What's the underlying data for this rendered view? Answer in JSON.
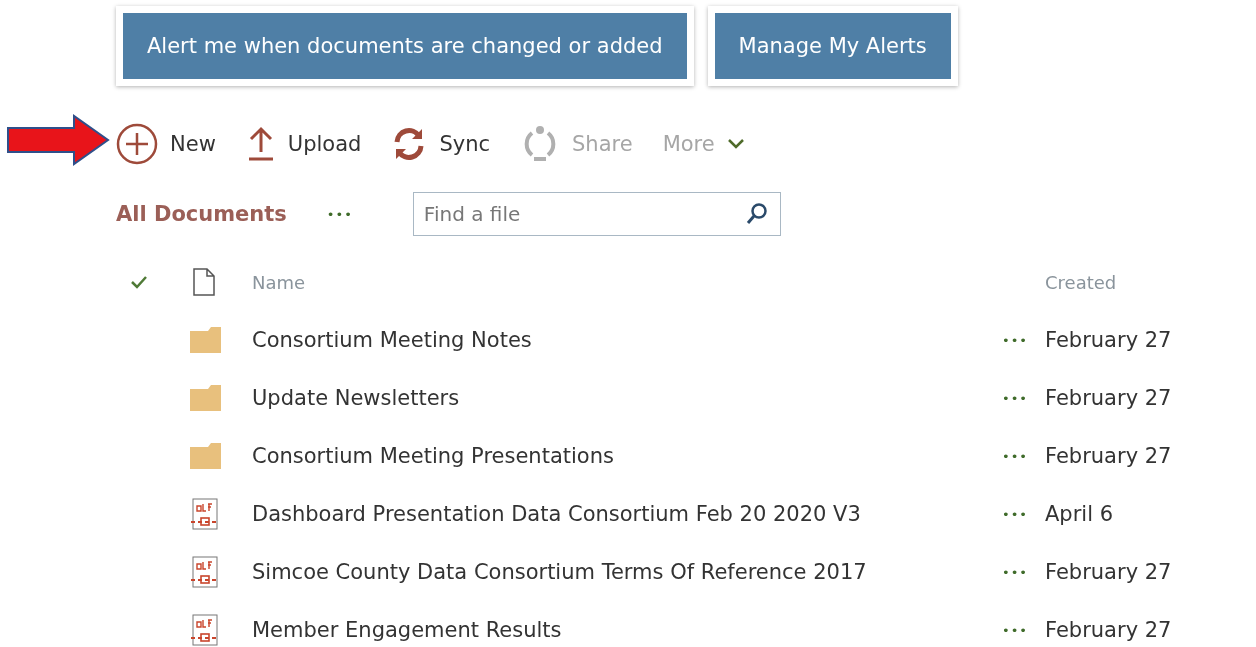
{
  "alert_buttons": [
    {
      "label": "Alert me when documents are changed or added"
    },
    {
      "label": "Manage My Alerts"
    }
  ],
  "command_bar": [
    {
      "kind": "new",
      "label": "New",
      "disabled": false
    },
    {
      "kind": "upload",
      "label": "Upload",
      "disabled": false
    },
    {
      "kind": "sync",
      "label": "Sync",
      "disabled": false
    },
    {
      "kind": "share",
      "label": "Share",
      "disabled": true
    },
    {
      "kind": "more",
      "label": "More",
      "disabled": true
    }
  ],
  "view": {
    "label": "All Documents",
    "more": "•••"
  },
  "search": {
    "placeholder": "Find a file"
  },
  "table": {
    "columns": [
      {
        "label": "Name"
      },
      {
        "label": "Created"
      }
    ],
    "rows": [
      {
        "kind": "folder",
        "name": "Consortium Meeting Notes",
        "actions": "•••",
        "created": "February 27"
      },
      {
        "kind": "folder",
        "name": "Update Newsletters",
        "actions": "•••",
        "created": "February 27"
      },
      {
        "kind": "folder",
        "name": "Consortium Meeting Presentations",
        "actions": "•••",
        "created": "February 27"
      },
      {
        "kind": "pdf",
        "name": "Dashboard Presentation Data Consortium Feb 20 2020 V3",
        "actions": "•••",
        "created": "April 6"
      },
      {
        "kind": "pdf",
        "name": "Simcoe County Data Consortium Terms Of Reference 2017",
        "actions": "•••",
        "created": "February 27"
      },
      {
        "kind": "pdf",
        "name": "Member Engagement Results",
        "actions": "•••",
        "created": "February 27"
      }
    ]
  }
}
